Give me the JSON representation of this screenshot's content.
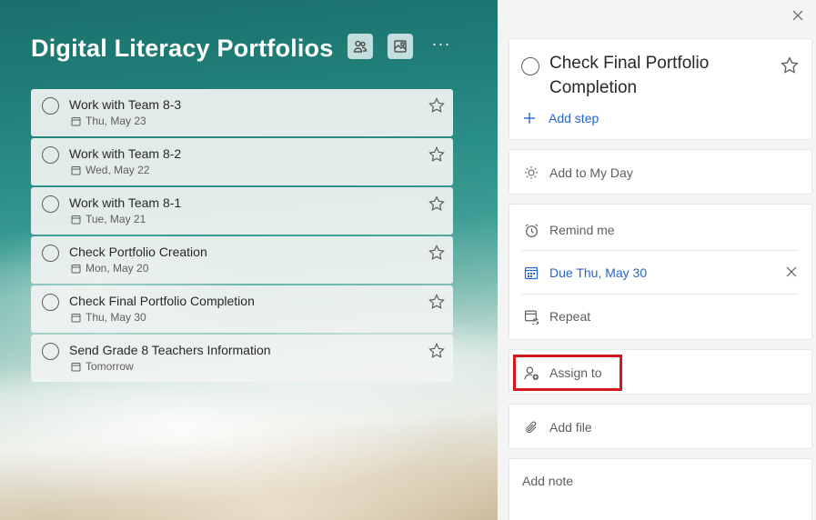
{
  "list": {
    "title": "Digital Literacy Portfolios",
    "header_icons": [
      "people-share-icon",
      "background-image-icon",
      "more-options-icon"
    ],
    "more_label": "···"
  },
  "tasks": [
    {
      "title": "Work with Team 8-3",
      "due": "Thu, May 23"
    },
    {
      "title": "Work with Team 8-2",
      "due": "Wed, May 22"
    },
    {
      "title": "Work with Team 8-1",
      "due": "Tue, May 21"
    },
    {
      "title": "Check Portfolio Creation",
      "due": "Mon, May 20"
    },
    {
      "title": "Check Final Portfolio Completion",
      "due": "Thu, May 30"
    },
    {
      "title": "Send Grade 8 Teachers Information",
      "due": "Tomorrow"
    }
  ],
  "detail": {
    "title": "Check Final Portfolio Completion",
    "add_step": "Add step",
    "add_to_my_day": "Add to My Day",
    "remind_me": "Remind me",
    "due": "Due Thu, May 30",
    "repeat": "Repeat",
    "assign_to": "Assign to",
    "add_file": "Add file",
    "add_note": "Add note"
  },
  "colors": {
    "accent": "#2564cf",
    "highlight": "#d4171f",
    "panel_bg": "#f4f4f4"
  }
}
